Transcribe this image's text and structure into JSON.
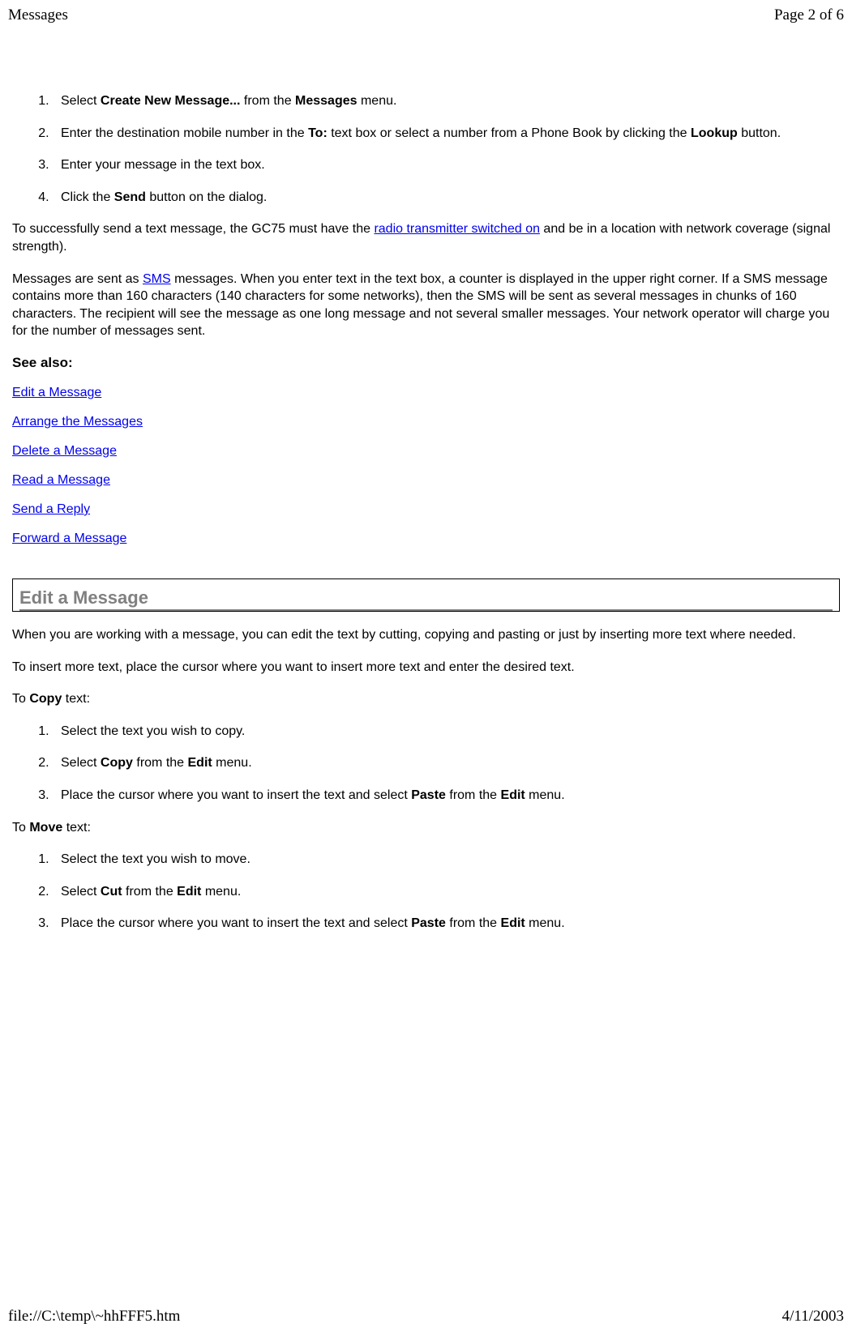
{
  "header": {
    "title": "Messages",
    "pageInfo": "Page 2 of 6"
  },
  "steps1": {
    "item1": {
      "pre": "Select ",
      "b1": "Create New Message...",
      "mid": " from the ",
      "b2": "Messages",
      "post": " menu."
    },
    "item2": {
      "pre": "Enter the destination mobile number in the ",
      "b1": "To:",
      "mid": " text box or select a number from a Phone Book by clicking the ",
      "b2": "Lookup",
      "post": " button."
    },
    "item3": "Enter your message in the text box.",
    "item4": {
      "pre": "Click the ",
      "b1": "Send",
      "post": " button on the dialog."
    }
  },
  "para1": {
    "pre": "To successfully send a text message, the GC75 must have the ",
    "link": "radio transmitter switched on",
    "post": " and be in a location with network coverage (signal strength)."
  },
  "para2": {
    "pre": "Messages are sent as ",
    "link": "SMS",
    "post": " messages. When you enter text in the text box, a counter is displayed in the upper right corner. If a SMS message contains more than 160 characters (140 characters for some networks), then the SMS will be sent as several messages in chunks of 160 characters. The recipient will see the message as one long message and not several smaller messages. Your network operator will charge you for the number of messages sent."
  },
  "seeAlso": "See also:",
  "links": {
    "l1": "Edit a Message",
    "l2": "Arrange the Messages",
    "l3": "Delete a Message",
    "l4": "Read a Message",
    "l5": "Send a Reply",
    "l6": "Forward a Message"
  },
  "section2": {
    "title": "Edit a Message",
    "p1": "When you are working with a message, you can edit the text by cutting, copying and pasting or just by inserting more text where needed.",
    "p2": "To insert more text, place the cursor where you want to insert more text and enter the desired text.",
    "copyIntro": {
      "pre": "To ",
      "b": "Copy",
      "post": " text:"
    },
    "copySteps": {
      "s1": "Select the text you wish to copy.",
      "s2": {
        "pre": "Select ",
        "b1": "Copy",
        "mid": " from the ",
        "b2": "Edit",
        "post": " menu."
      },
      "s3": {
        "pre": "Place the cursor where you want to insert the text and select ",
        "b1": "Paste",
        "mid": " from the ",
        "b2": "Edit",
        "post": " menu."
      }
    },
    "moveIntro": {
      "pre": "To ",
      "b": "Move",
      "post": " text:"
    },
    "moveSteps": {
      "s1": "Select the text you wish to move.",
      "s2": {
        "pre": "Select ",
        "b1": "Cut",
        "mid": " from the ",
        "b2": "Edit",
        "post": " menu."
      },
      "s3": {
        "pre": "Place the cursor where you want to insert the text and select ",
        "b1": "Paste",
        "mid": " from the ",
        "b2": "Edit",
        "post": " menu."
      }
    }
  },
  "footer": {
    "path": "file://C:\\temp\\~hhFFF5.htm",
    "date": "4/11/2003"
  }
}
